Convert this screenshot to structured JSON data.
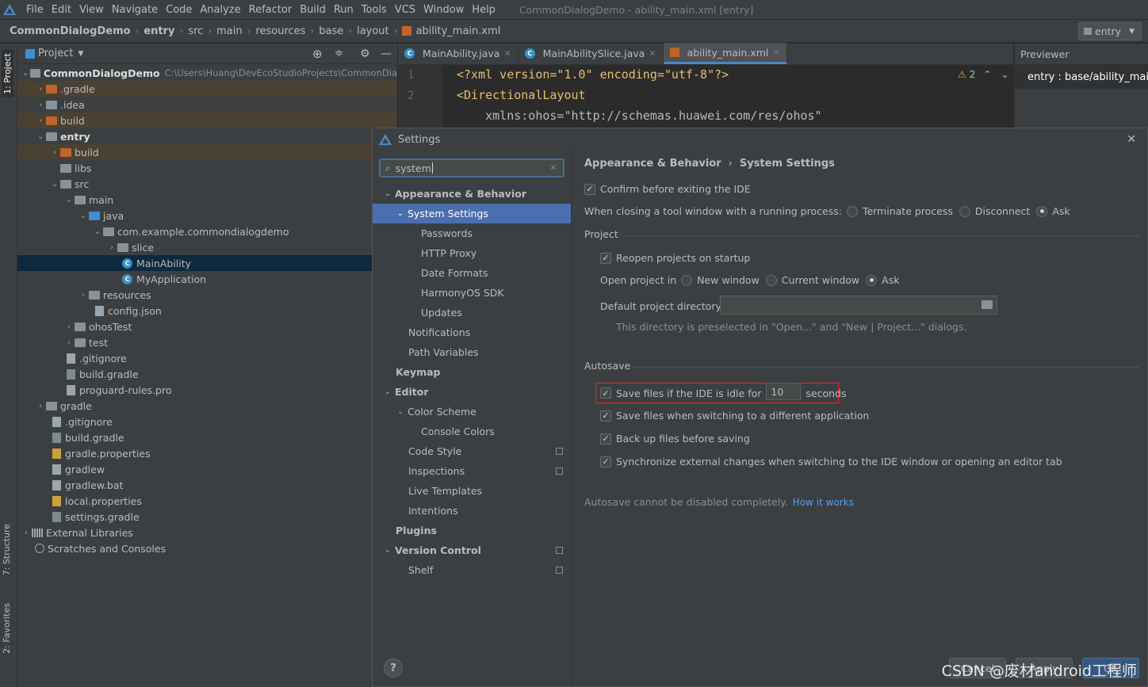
{
  "menu": {
    "items": [
      "File",
      "Edit",
      "View",
      "Navigate",
      "Code",
      "Analyze",
      "Refactor",
      "Build",
      "Run",
      "Tools",
      "VCS",
      "Window",
      "Help"
    ],
    "window_title": "CommonDialogDemo - ability_main.xml [entry]"
  },
  "breadcrumb": [
    "CommonDialogDemo",
    "entry",
    "src",
    "main",
    "resources",
    "base",
    "layout",
    "ability_main.xml"
  ],
  "run_config": "entry",
  "side_tabs": {
    "project": "1: Project",
    "structure": "7: Structure",
    "favorites": "2: Favorites"
  },
  "project_panel": {
    "title": "Project",
    "tree": [
      {
        "label": "CommonDialogDemo",
        "path": "C:\\Users\\Huang\\DevEcoStudioProjects\\CommonDia"
      },
      {
        "label": ".gradle"
      },
      {
        "label": ".idea"
      },
      {
        "label": "build"
      },
      {
        "label": "entry"
      },
      {
        "label": "build"
      },
      {
        "label": "libs"
      },
      {
        "label": "src"
      },
      {
        "label": "main"
      },
      {
        "label": "java"
      },
      {
        "label": "com.example.commondialogdemo"
      },
      {
        "label": "slice"
      },
      {
        "label": "MainAbility"
      },
      {
        "label": "MyApplication"
      },
      {
        "label": "resources"
      },
      {
        "label": "config.json"
      },
      {
        "label": "ohosTest"
      },
      {
        "label": "test"
      },
      {
        "label": ".gitignore"
      },
      {
        "label": "build.gradle"
      },
      {
        "label": "proguard-rules.pro"
      },
      {
        "label": "gradle"
      },
      {
        "label": ".gitignore"
      },
      {
        "label": "build.gradle"
      },
      {
        "label": "gradle.properties"
      },
      {
        "label": "gradlew"
      },
      {
        "label": "gradlew.bat"
      },
      {
        "label": "local.properties"
      },
      {
        "label": "settings.gradle"
      },
      {
        "label": "External Libraries"
      },
      {
        "label": "Scratches and Consoles"
      }
    ]
  },
  "editor_tabs": [
    "MainAbility.java",
    "MainAbilitySlice.java",
    "ability_main.xml"
  ],
  "editor": {
    "line_numbers": [
      "1",
      "2"
    ],
    "lines": [
      {
        "text": "<?xml version=\"1.0\" encoding=\"utf-8\"?>"
      },
      {
        "text": "<DirectionalLayout"
      },
      {
        "text": "    xmlns:ohos=\"http://schemas.huawei.com/res/ohos\""
      }
    ],
    "warnings": "2"
  },
  "previewer": {
    "title": "Previewer",
    "file": "entry : base/ability_main"
  },
  "dialog": {
    "title": "Settings",
    "search_value": "system",
    "nav": [
      {
        "label": "Appearance & Behavior"
      },
      {
        "label": "System Settings"
      },
      {
        "label": "Passwords"
      },
      {
        "label": "HTTP Proxy"
      },
      {
        "label": "Date Formats"
      },
      {
        "label": "HarmonyOS SDK"
      },
      {
        "label": "Updates"
      },
      {
        "label": "Notifications"
      },
      {
        "label": "Path Variables"
      },
      {
        "label": "Keymap"
      },
      {
        "label": "Editor"
      },
      {
        "label": "Color Scheme"
      },
      {
        "label": "Console Colors"
      },
      {
        "label": "Code Style"
      },
      {
        "label": "Inspections"
      },
      {
        "label": "Live Templates"
      },
      {
        "label": "Intentions"
      },
      {
        "label": "Plugins"
      },
      {
        "label": "Version Control"
      },
      {
        "label": "Shelf"
      }
    ],
    "breadcrumb": {
      "parent": "Appearance & Behavior",
      "current": "System Settings"
    },
    "confirm_exit": "Confirm before exiting the IDE",
    "closing_label": "When closing a tool window with a running process:",
    "closing_options": [
      "Terminate process",
      "Disconnect",
      "Ask"
    ],
    "project_group": "Project",
    "reopen": "Reopen projects on startup",
    "open_in_label": "Open project in",
    "open_in_options": [
      "New window",
      "Current window",
      "Ask"
    ],
    "default_dir_label": "Default project directory:",
    "default_dir_value": "",
    "dir_hint": "This directory is preselected in \"Open...\" and \"New | Project...\" dialogs.",
    "autosave_group": "Autosave",
    "save_idle_label": "Save files if the IDE is idle for",
    "save_idle_value": "10",
    "save_idle_unit": "seconds",
    "save_switch": "Save files when switching to a different application",
    "backup": "Back up files before saving",
    "sync": "Synchronize external changes when switching to the IDE window or opening an editor tab",
    "autosave_hint": "Autosave cannot be disabled completely.",
    "how_link": "How it works",
    "buttons": {
      "help": "?",
      "cancel": "Cancel",
      "apply": "Apply",
      "ok": "OK"
    }
  },
  "watermark": "CSDN @废材android工程师",
  "colors": {
    "accent": "#4b6eaf",
    "highlight_box": "#e22b2b",
    "selection": "#0d293e"
  }
}
